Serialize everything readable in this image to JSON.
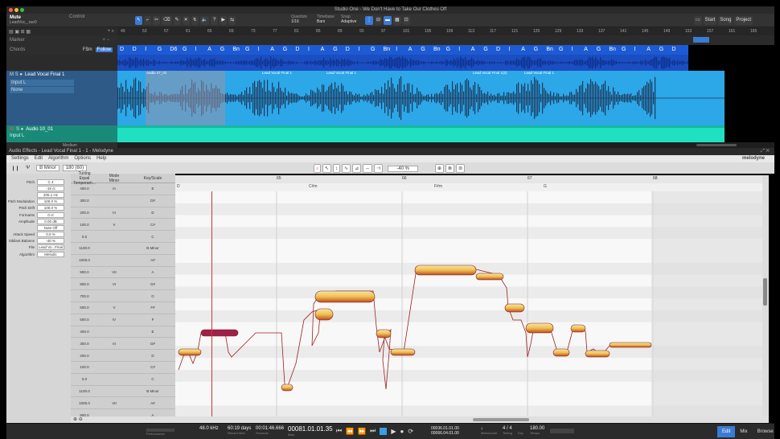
{
  "window": {
    "title": "Studio One - We Don't Have to Take Our Clothes Off"
  },
  "toolbar": {
    "song_title": "Mute",
    "song_file": "LeadVoc_.rae0",
    "control_label": "Control",
    "quantize_label": "Quantize",
    "quantize_value": "1/16",
    "timebase_label": "Timebase",
    "timebase_value": "Bars",
    "snap_label": "Snap",
    "snap_value": "Adaptive",
    "start_label": "Start",
    "song_label": "Song",
    "project_label": "Project"
  },
  "ruler": {
    "bars": [
      "49",
      "53",
      "57",
      "61",
      "65",
      "69",
      "73",
      "77",
      "81",
      "85",
      "89",
      "93",
      "97",
      "101",
      "105",
      "109",
      "113",
      "117",
      "121",
      "125",
      "129",
      "133",
      "137",
      "141",
      "145",
      "149",
      "153",
      "157",
      "161",
      "165"
    ]
  },
  "tracks": {
    "marker_label": "Marker",
    "chords_label": "Chords",
    "chords_key": "F$m",
    "follow_label": "Follow",
    "vocal_name": "Lead Vocal Final 1",
    "vocal_input": "Input L",
    "vocal_none": "None",
    "audio_name": "Audio 10_01",
    "audio_input": "Input L",
    "medium_label": "Medium",
    "chord_symbols": [
      "D",
      "D",
      "I",
      "G",
      "D6",
      "G",
      "I",
      "A",
      "G",
      "Bn",
      "G",
      "I",
      "A",
      "G",
      "D",
      "I",
      "A",
      "G",
      "D",
      "I",
      "G",
      "Bn",
      "I",
      "A",
      "G",
      "Bn",
      "G",
      "I",
      "A",
      "G",
      "D",
      "I",
      "A",
      "G",
      "Bn",
      "G",
      "I",
      "A",
      "G",
      "Bn",
      "G",
      "I",
      "A",
      "G",
      "D"
    ],
    "clip_labels": [
      "Audio 27_01",
      "Lead Vocal Final 1",
      "Lead Vocal Final 1",
      "Lead Vocal Final 1(2)",
      "Lead Vocal Final 1"
    ]
  },
  "melodyne": {
    "panel_title": "Audio Effects - Lead Vocal Final 1 - 1 - Melodyne",
    "brand": "melodyne",
    "menu": [
      "Settings",
      "Edit",
      "Algorithm",
      "Options",
      "Help"
    ],
    "key_value": "B Minor",
    "tempo_value": "180 (60)",
    "zoom_value": "-40 %",
    "params": [
      {
        "label": "Pitch",
        "value": "C 4"
      },
      {
        "label": "",
        "value": "-19 ct"
      },
      {
        "label": "",
        "value": "205.1 Hz"
      },
      {
        "label": "Pitch Modulation",
        "value": "100.0 %"
      },
      {
        "label": "Pitch Drift",
        "value": "100.0 %"
      },
      {
        "label": "Formants",
        "value": "0 ct"
      },
      {
        "label": "Amplitude",
        "value": "0.00 dB"
      },
      {
        "label": "",
        "value": "Note Off"
      },
      {
        "label": "Attack Speed",
        "value": "0.0 %"
      },
      {
        "label": "Sibilant Balance",
        "value": "-40 %"
      },
      {
        "label": "File",
        "value": "Lead Vo...Final 1"
      },
      {
        "label": "Algorithm",
        "value": "Melodic"
      }
    ],
    "tuning_header": "Tuning",
    "tuning_sub": "Equal Temperam...",
    "mode_header": "Mode",
    "mode_sub": "Minor",
    "keynote_header": "Key/Scale",
    "tuning_values": [
      "400.0",
      "300.0",
      "200.0",
      "100.0",
      "0.0",
      "1100.0",
      "1000.0",
      "900.0",
      "800.0",
      "700.0",
      "600.0",
      "500.0",
      "400.0",
      "300.0",
      "200.0",
      "100.0",
      "0.0",
      "1100.0",
      "1000.0",
      "900.0"
    ],
    "mode_notes": [
      "m",
      "",
      "III",
      "V",
      "",
      "",
      "",
      "VII",
      "VI",
      "",
      "V",
      "IV",
      "",
      "III",
      "",
      "",
      "",
      "",
      "VII",
      ""
    ],
    "key_notes": [
      "E",
      "D#",
      "D",
      "C#",
      "C",
      "B Minor",
      "A#",
      "A",
      "G#",
      "G",
      "F#",
      "F",
      "E",
      "D#",
      "D",
      "C#",
      "C",
      "B Minor",
      "A#",
      "A"
    ],
    "bar_labels": [
      "65",
      "66",
      "67",
      "68"
    ],
    "chord_labels": [
      "D",
      "C#m",
      "F#m",
      "G"
    ]
  },
  "transport": {
    "sample_rate": "48.0 kHz",
    "record_max": "60:19 days",
    "time_seconds": "00:01:46.666",
    "position_bars": "00081.01.01.35",
    "loop_start": "00036.01.01.00",
    "loop_end": "00066.04.01.00",
    "signature": "4 / 4",
    "tempo": "180.00",
    "labels": {
      "performance": "Performance",
      "record_max": "Record Max",
      "seconds": "Seconds",
      "bars": "Bars",
      "metronome": "Metronome",
      "timing": "Timing",
      "key": "Key",
      "tempo": "Tempo"
    },
    "tabs": [
      "Edit",
      "Mix",
      "Browse"
    ]
  }
}
